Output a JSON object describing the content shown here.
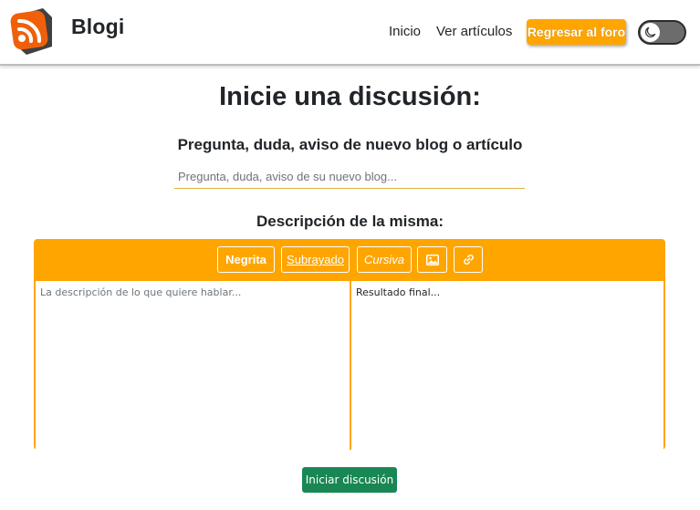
{
  "navbar": {
    "brand": "Blogi",
    "links": [
      {
        "label": "Inicio"
      },
      {
        "label": "Ver artículos"
      }
    ],
    "return_button": "Regresar al foro",
    "theme_toggle_icon": "moon-icon",
    "logo_icon": "rss-icon"
  },
  "main": {
    "title": "Inicie una discusión:",
    "question_label": "Pregunta, duda, aviso de nuevo blog o artículo",
    "question_placeholder": "Pregunta, duda, aviso de su nuevo blog...",
    "description_label": "Descripción de la misma:",
    "toolbar": {
      "bold": "Negrita",
      "underline": "Subrayado",
      "italic": "Cursiva",
      "image_icon": "image-icon",
      "link_icon": "link-icon"
    },
    "editor_placeholder": "La descripción de lo que quiere hablar...",
    "result_text": "Resultado final...",
    "submit_button": "Iniciar discusión"
  },
  "colors": {
    "accent": "#ffa500",
    "success": "#198754",
    "text": "#212529"
  }
}
